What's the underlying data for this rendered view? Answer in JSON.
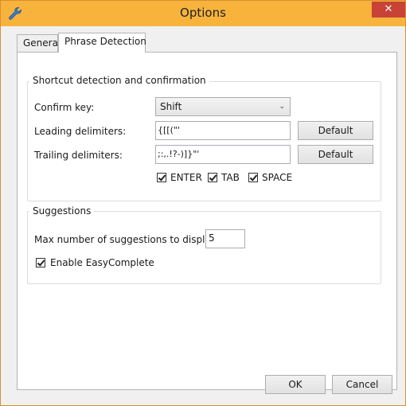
{
  "window": {
    "title": "Options",
    "close_glyph": "✕",
    "app_icon": "wrench-icon",
    "title_bar_color": "#f7b33c",
    "close_button_color": "#c94236"
  },
  "tabs": [
    {
      "label": "General"
    },
    {
      "label": "Phrase Detection"
    }
  ],
  "shortcut_group": {
    "title": "Shortcut detection and confirmation",
    "confirm_key": {
      "label": "Confirm key:",
      "value": "Shift"
    },
    "leading": {
      "label": "Leading delimiters:",
      "value": "{[[(\"'",
      "button": "Default"
    },
    "trailing": {
      "label": "Trailing delimiters:",
      "value": ";:,.!?-)]}\"'",
      "button": "Default"
    },
    "checkboxes": [
      {
        "label": "ENTER",
        "checked": true
      },
      {
        "label": "TAB",
        "checked": true
      },
      {
        "label": "SPACE",
        "checked": true
      }
    ]
  },
  "suggestions_group": {
    "title": "Suggestions",
    "max": {
      "label": "Max number of suggestions to display:",
      "value": "5"
    },
    "enable": {
      "label": "Enable EasyComplete",
      "checked": true
    }
  },
  "footer": {
    "ok": "OK",
    "cancel": "Cancel"
  }
}
